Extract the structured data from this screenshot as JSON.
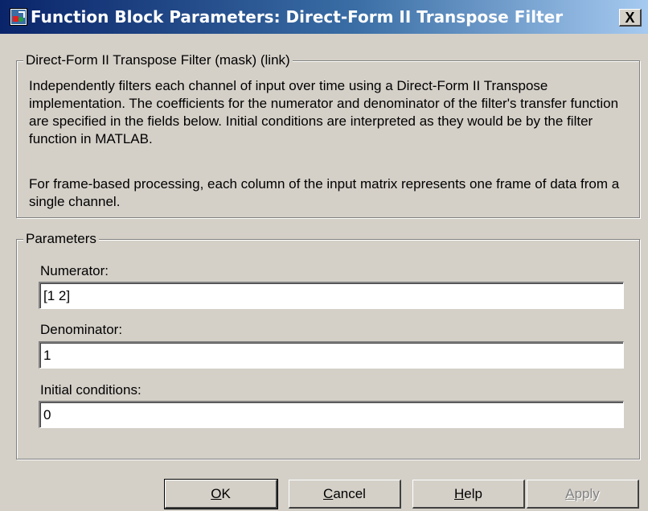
{
  "window": {
    "title": "Function Block Parameters: Direct-Form II Transpose Filter",
    "close_glyph": "X",
    "icon": "simulink-block-icon"
  },
  "description_group": {
    "title": "Direct-Form II Transpose Filter (mask) (link)",
    "paragraphs": [
      "Independently filters each channel of input over time using a Direct-Form II Transpose implementation.  The coefficients for the numerator and denominator of the filter's transfer function are specified in the fields below.  Initial conditions are interpreted as they would be by the filter function in MATLAB.",
      "For frame-based processing, each column of the input matrix represents one frame of data from a single channel."
    ]
  },
  "parameters_group": {
    "title": "Parameters",
    "fields": [
      {
        "label": "Numerator:",
        "value": "[1 2]"
      },
      {
        "label": "Denominator:",
        "value": "1"
      },
      {
        "label": "Initial conditions:",
        "value": "0"
      }
    ]
  },
  "buttons": {
    "ok": {
      "mnemonic": "O",
      "rest": "K"
    },
    "cancel": {
      "mnemonic": "C",
      "rest": "ancel"
    },
    "help": {
      "mnemonic": "H",
      "rest": "elp"
    },
    "apply": {
      "mnemonic": "A",
      "rest": "pply",
      "disabled": true
    }
  }
}
